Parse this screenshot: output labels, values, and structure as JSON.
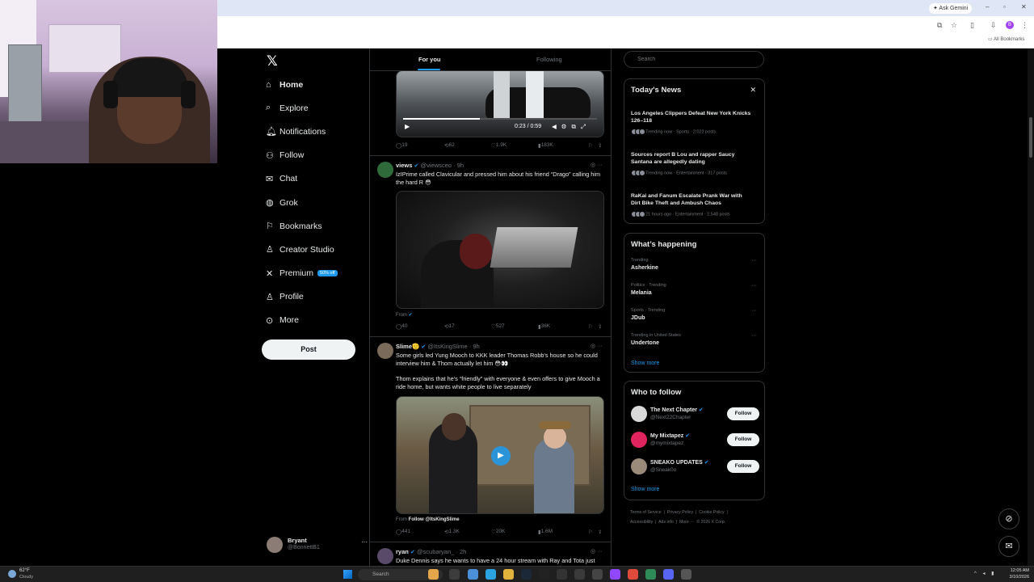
{
  "browser": {
    "ask_gemini": "✦ Ask Gemini",
    "all_bookmarks": "All Bookmarks",
    "profile_initial": "B"
  },
  "nav": {
    "items": [
      {
        "label": "Home",
        "icon": "home-icon",
        "glyph": "⌂"
      },
      {
        "label": "Explore",
        "icon": "search-icon",
        "glyph": "⌕"
      },
      {
        "label": "Notifications",
        "icon": "bell-icon",
        "glyph": "🔔︎"
      },
      {
        "label": "Follow",
        "icon": "person-add-icon",
        "glyph": "⚇"
      },
      {
        "label": "Chat",
        "icon": "chat-icon",
        "glyph": "✉"
      },
      {
        "label": "Grok",
        "icon": "grok-icon",
        "glyph": "◍"
      },
      {
        "label": "Bookmarks",
        "icon": "bookmark-icon",
        "glyph": "⚐"
      },
      {
        "label": "Creator Studio",
        "icon": "creator-icon",
        "glyph": "♙"
      },
      {
        "label": "Premium",
        "icon": "x-icon",
        "glyph": "✕",
        "badge": "50% off"
      },
      {
        "label": "Profile",
        "icon": "profile-icon",
        "glyph": "♙"
      },
      {
        "label": "More",
        "icon": "more-icon",
        "glyph": "⊙"
      }
    ],
    "post_label": "Post",
    "account": {
      "name": "Bryant",
      "handle": "@BonnettB1"
    }
  },
  "feed": {
    "tabs": [
      "For you",
      "Following"
    ],
    "video1": {
      "time": "0:23 / 0:59"
    },
    "actions1": {
      "replies": "19",
      "reposts": "62",
      "likes": "1.9K",
      "views": "183K"
    },
    "tweet2": {
      "name": "views",
      "handle": "@viewsceo",
      "time": "9h",
      "text": "IzIPrime called Clavicular and pressed him about his friend “Drago” calling him the hard R 😳",
      "from": "From"
    },
    "actions2": {
      "replies": "40",
      "reposts": "17",
      "likes": "527",
      "views": "36K"
    },
    "tweet3": {
      "name": "Slime🫡",
      "handle": "@ItsKingSlime",
      "time": "9h",
      "text1": "Some girls led Yung Mooch to KKK leader Thomas Robb's house so he could interview him & Thom actually let him 😳👀",
      "text2": "Thom explains that he's “friendly” with everyone & even offers to give Mooch a ride home, but wants white people to live separately",
      "from_prefix": "From",
      "from_link": "Follow @ItsKingSlime"
    },
    "actions3": {
      "replies": "441",
      "reposts": "1.3K",
      "likes": "20K",
      "views": "1.6M"
    },
    "tweet4": {
      "name": "ryan",
      "handle": "@scubaryan_",
      "time": "2h",
      "text": "Duke Dennis says he wants to have a 24 hour stream with Ray and Tota just"
    }
  },
  "right": {
    "search_placeholder": "Search",
    "news": {
      "title": "Today's News",
      "items": [
        {
          "title": "Los Angeles Clippers Defeat New York Knicks 126–118",
          "meta": "Trending now · Sports · 2,022 posts"
        },
        {
          "title": "Sources report B Lou and rapper Saucy Santana are allegedly dating",
          "meta": "Trending now · Entertainment · 317 posts"
        },
        {
          "title": "RaKai and Fanum Escalate Prank War with Dirt Bike Theft and Ambush Chaos",
          "meta": "21 hours ago · Entertainment · 2,548 posts"
        }
      ]
    },
    "happening": {
      "title": "What’s happening",
      "items": [
        {
          "category": "Trending",
          "name": "Asherkine"
        },
        {
          "category": "Politics · Trending",
          "name": "Melania"
        },
        {
          "category": "Sports · Trending",
          "name": "JDub"
        },
        {
          "category": "Trending in United States",
          "name": "Undertone"
        }
      ],
      "show_more": "Show more"
    },
    "who_to_follow": {
      "title": "Who to follow",
      "items": [
        {
          "name": "The Next Chapter",
          "handle": "@Next22Chapter",
          "button": "Follow"
        },
        {
          "name": "My Mixtapez",
          "handle": "@mymixtapez",
          "button": "Follow"
        },
        {
          "name": "SNEAKO UPDATES",
          "handle": "@Sneak0o",
          "button": "Follow"
        }
      ],
      "show_more": "Show more"
    },
    "footer": [
      "Terms of Service",
      "Privacy Policy",
      "Cookie Policy",
      "Accessibility",
      "Ads info",
      "More ···",
      "© 2026 X Corp."
    ]
  },
  "taskbar": {
    "temp": "62°F",
    "weather": "Cloudy",
    "search_placeholder": "Search",
    "time": "12:05 AM",
    "date": "3/10/2026"
  },
  "colors": {
    "accent": "#1d9bf0",
    "background": "#000000",
    "border": "#2f3336"
  }
}
